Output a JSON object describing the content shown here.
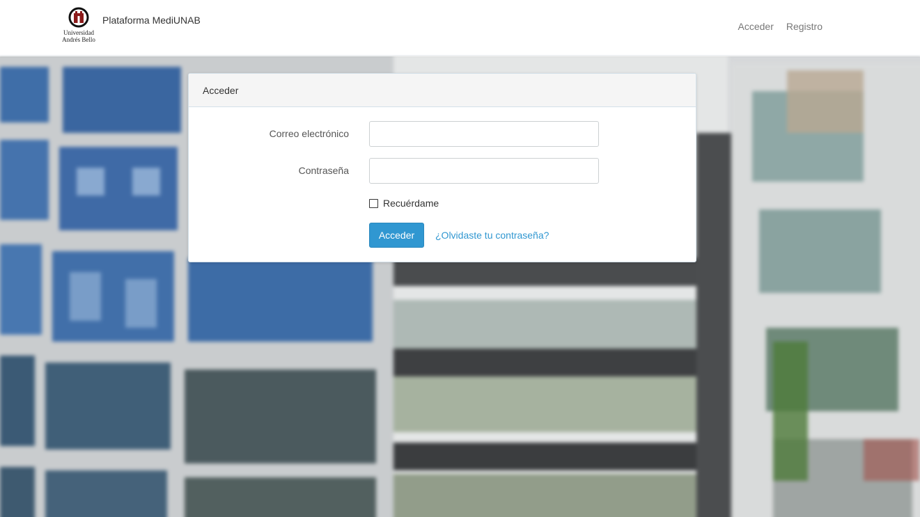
{
  "navbar": {
    "logo_lines": [
      "Universidad",
      "Andrés Bello"
    ],
    "brand": "Plataforma MediUNAB",
    "links": [
      {
        "label": "Acceder"
      },
      {
        "label": "Registro"
      }
    ]
  },
  "login_card": {
    "title": "Acceder",
    "email": {
      "label": "Correo electrónico",
      "value": "",
      "placeholder": ""
    },
    "password": {
      "label": "Contraseña",
      "value": "",
      "placeholder": ""
    },
    "remember": {
      "label": "Recuérdame",
      "checked": false
    },
    "submit_label": "Acceder",
    "forgot_label": "¿Olvidaste tu contraseña?"
  },
  "colors": {
    "primary": "#3097d1",
    "header_bg": "#f5f5f5",
    "navbar_bg": "#ffffff",
    "logo_red": "#8b1a1a"
  }
}
